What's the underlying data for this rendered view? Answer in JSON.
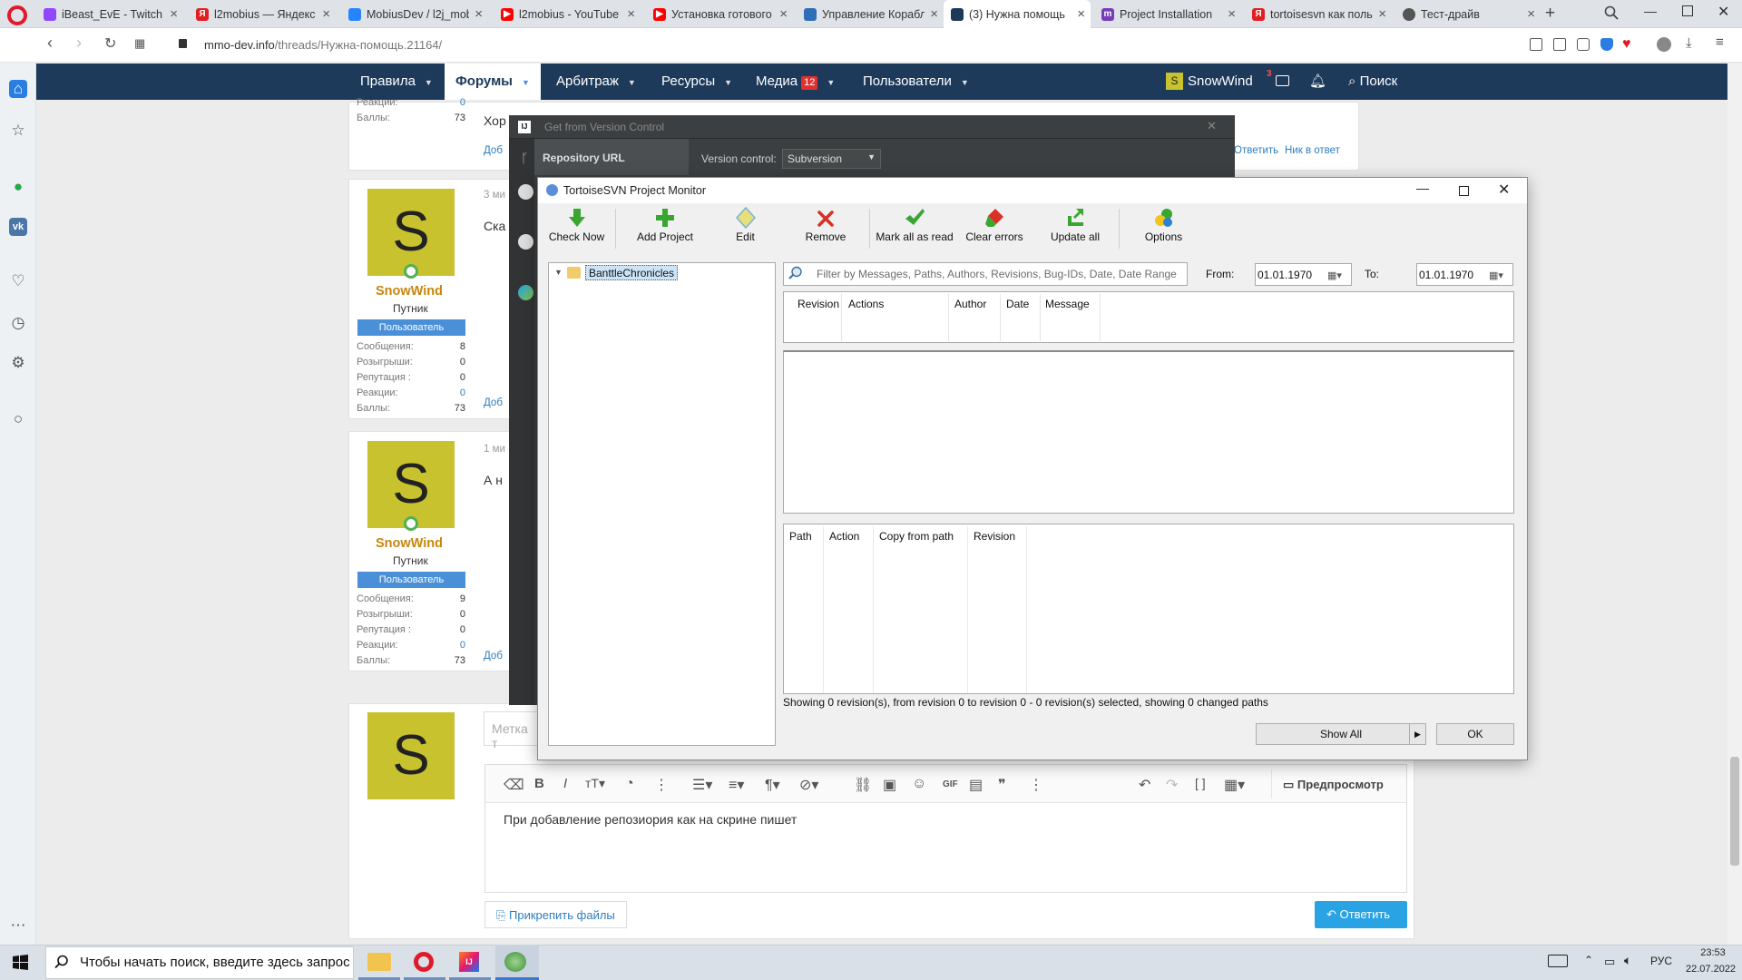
{
  "browser": {
    "tabs": [
      {
        "title": "iBeast_EvE - Twitch",
        "icon": "twitch-icon",
        "color": "#9146ff"
      },
      {
        "title": "l2mobius — Яндекс",
        "icon": "yandex-icon",
        "color": "#e02020"
      },
      {
        "title": "MobiusDev / l2j_mob",
        "icon": "bitbucket-icon",
        "color": "#2684ff"
      },
      {
        "title": "l2mobius - YouTube",
        "icon": "youtube-icon",
        "color": "#ff0000"
      },
      {
        "title": "Установка готового",
        "icon": "youtube-icon",
        "color": "#ff0000"
      },
      {
        "title": "Управление Корабл",
        "icon": "doc-icon",
        "color": "#2f6fb7"
      },
      {
        "title": "(3) Нужна помощь",
        "icon": "forum-icon",
        "color": "#1d3a5b"
      },
      {
        "title": "Project Installation",
        "icon": "m-icon",
        "color": "#7a3db8"
      },
      {
        "title": "tortoisesvn как поль",
        "icon": "yandex-icon",
        "color": "#e02020"
      },
      {
        "title": "Тест-драйв",
        "icon": "globe-icon",
        "color": "#555555"
      }
    ],
    "url_host": "mmo-dev.info",
    "url_path": "/threads/Нужна-помощь.21164/"
  },
  "forum": {
    "nav": [
      {
        "label": "Правила"
      },
      {
        "label": "Форумы"
      },
      {
        "label": "Арбитраж"
      },
      {
        "label": "Ресурсы"
      },
      {
        "label": "Медиа",
        "badge": "12"
      },
      {
        "label": "Пользователи"
      }
    ],
    "user": "SnowWind",
    "user_initial": "S",
    "notif_count": "3",
    "search": "Поиск",
    "top_post": {
      "stats": [
        {
          "label": "Реакции:",
          "value": "0"
        },
        {
          "label": "Баллы:",
          "value": "73"
        }
      ],
      "text": "Хор",
      "action": "Доб",
      "reply": "Ответить",
      "quote": "Ник в ответ"
    },
    "posts": [
      {
        "avatar": "S",
        "name": "SnowWind",
        "title": "Путник",
        "badge": "Пользователь",
        "time": "3 ми",
        "text": "Ска",
        "action": "Доб",
        "stats": [
          {
            "label": "Сообщения:",
            "value": "8"
          },
          {
            "label": "Розыгрыши:",
            "value": "0"
          },
          {
            "label": "Репутация :",
            "value": "0"
          },
          {
            "label": "Реакции:",
            "value": "0"
          },
          {
            "label": "Баллы:",
            "value": "73"
          }
        ]
      },
      {
        "avatar": "S",
        "name": "SnowWind",
        "title": "Путник",
        "badge": "Пользователь",
        "time": "1 ми",
        "text": "А н",
        "action": "Доб",
        "stats": [
          {
            "label": "Сообщения:",
            "value": "9"
          },
          {
            "label": "Розыгрыши:",
            "value": "0"
          },
          {
            "label": "Репутация :",
            "value": "0"
          },
          {
            "label": "Реакции:",
            "value": "0"
          },
          {
            "label": "Баллы:",
            "value": "73"
          }
        ]
      }
    ],
    "reply_avatar": "S",
    "tag_placeholder": "Метка т",
    "editor_text": "При добавление репозиория как на скрине пишет",
    "preview": "Предпросмотр",
    "attach": "Прикрепить файлы",
    "reply_button": "Ответить"
  },
  "ide": {
    "title": "Get from Version Control",
    "repo_url": "Repository URL",
    "vc_label": "Version control:",
    "vc_value": "Subversion"
  },
  "svn": {
    "title": "TortoiseSVN Project Monitor",
    "toolbar": {
      "check_now": "Check Now",
      "add_project": "Add Project",
      "edit": "Edit",
      "remove": "Remove",
      "mark_read": "Mark all as read",
      "clear_errors": "Clear errors",
      "update_all": "Update all",
      "options": "Options"
    },
    "tree_item": "BanttleChronicles",
    "filter_placeholder": "Filter by Messages, Paths, Authors, Revisions, Bug-IDs, Date, Date Range",
    "from_label": "From:",
    "from_value": "01.01.1970",
    "to_label": "To:",
    "to_value": "01.01.1970",
    "log_columns": [
      "Revision",
      "Actions",
      "Author",
      "Date",
      "Message"
    ],
    "path_columns": [
      "Path",
      "Action",
      "Copy from path",
      "Revision"
    ],
    "status": "Showing 0 revision(s), from revision 0 to revision 0 - 0 revision(s) selected, showing 0 changed paths",
    "show_all": "Show All",
    "ok": "OK"
  },
  "taskbar": {
    "search_placeholder": "Чтобы начать поиск, введите здесь запрос",
    "lang": "РУС",
    "time": "23:53",
    "date": "22.07.2022"
  }
}
